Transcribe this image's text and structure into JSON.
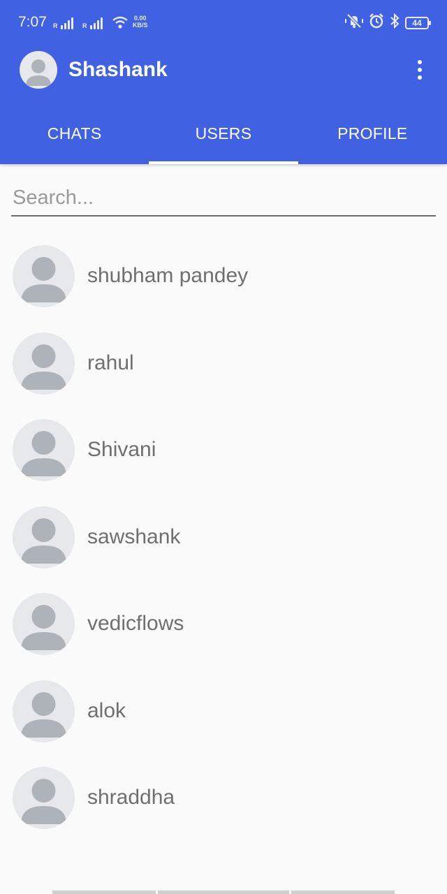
{
  "status_bar": {
    "time": "7:07",
    "sim1_label": "R",
    "sim2_label": "R",
    "net_speed_value": "0.00",
    "net_speed_unit": "KB/S",
    "battery": "44",
    "icons": [
      "signal-icon",
      "wifi-icon",
      "mute-icon",
      "alarm-icon",
      "bluetooth-icon",
      "battery-icon"
    ]
  },
  "toolbar": {
    "title": "Shashank",
    "avatar_icon": "person-icon",
    "menu_icon": "more-vert-icon"
  },
  "tabs": [
    {
      "label": "CHATS",
      "active": false
    },
    {
      "label": "USERS",
      "active": true
    },
    {
      "label": "PROFILE",
      "active": false
    }
  ],
  "search": {
    "placeholder": "Search...",
    "value": ""
  },
  "users": [
    {
      "name": "shubham pandey"
    },
    {
      "name": "rahul"
    },
    {
      "name": "Shivani"
    },
    {
      "name": "sawshank"
    },
    {
      "name": "vedicflows"
    },
    {
      "name": "alok"
    },
    {
      "name": "shraddha"
    }
  ],
  "colors": {
    "primary": "#4161e3",
    "background": "#fafafa",
    "avatar_bg": "#e6e8eb",
    "avatar_fg": "#aeb3b9",
    "user_name_text": "#6f6f6f"
  }
}
